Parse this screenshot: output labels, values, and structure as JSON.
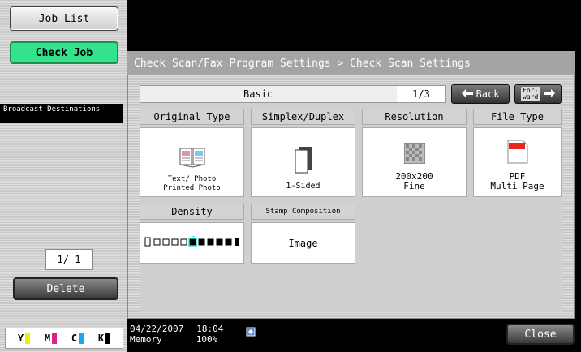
{
  "sidebar": {
    "job_list": "Job List",
    "check_job": "Check Job",
    "broadcast": "Broadcast Destinations",
    "page": "1/ 1",
    "delete": "Delete",
    "toner": [
      {
        "letter": "Y",
        "color": "#f7e800"
      },
      {
        "letter": "M",
        "color": "#e0208e"
      },
      {
        "letter": "C",
        "color": "#19a9e6"
      },
      {
        "letter": "K",
        "color": "#000000"
      }
    ]
  },
  "panel": {
    "title": "Check Scan/Fax Program Settings > Check Scan Settings",
    "tab": "Basic",
    "page": "1/3",
    "back": "Back",
    "forward": "For- ward"
  },
  "settings": {
    "original_type": {
      "header": "Original Type",
      "value_line1": "Text/ Photo",
      "value_line2": "Printed Photo"
    },
    "simplex_duplex": {
      "header": "Simplex/Duplex",
      "value": "1-Sided"
    },
    "resolution": {
      "header": "Resolution",
      "value_line1": "200x200",
      "value_line2": "Fine"
    },
    "file_type": {
      "header": "File Type",
      "badge": "PDF",
      "value_line1": "PDF",
      "value_line2": "Multi Page"
    },
    "density": {
      "header": "Density",
      "level": 5,
      "steps": 9
    },
    "stamp": {
      "header": "Stamp Composition",
      "value": "Image"
    }
  },
  "status": {
    "date": "04/22/2007",
    "time": "18:04",
    "memory_label": "Memory",
    "memory_value": "100%",
    "close": "Close"
  },
  "colors": {
    "accent_green": "#33e38c",
    "pdf_red": "#e8281e"
  }
}
